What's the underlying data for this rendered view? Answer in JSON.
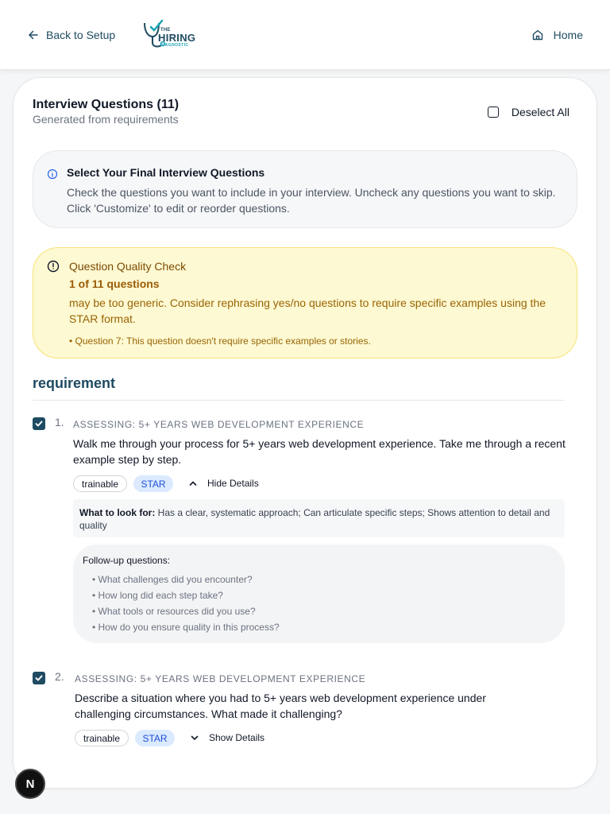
{
  "header": {
    "back_label": "Back to Setup",
    "logo": {
      "the": "THE",
      "hiring": "HIRING",
      "diagnostic": "DIAGNOSTIC"
    },
    "home_label": "Home"
  },
  "card": {
    "title": "Interview Questions (11)",
    "subtitle": "Generated from requirements",
    "deselect_label": "Deselect All"
  },
  "info": {
    "title": "Select Your Final Interview Questions",
    "body": "Check the questions you want to include in your interview. Uncheck any questions you want to skip. Click 'Customize' to edit or reorder questions."
  },
  "warning": {
    "title": "Question Quality Check",
    "count": "1 of 11 questions",
    "body": "may be too generic. Consider rephrasing yes/no questions to require specific examples using the STAR format.",
    "item": "• Question 7: This question doesn't require specific examples or stories."
  },
  "section": {
    "title": "requirement"
  },
  "questions": [
    {
      "num": "1.",
      "assessing": "ASSESSING: 5+ YEARS WEB DEVELOPMENT EXPERIENCE",
      "text": "Walk me through your process for 5+ years web development experience. Take me through a recent example step by step.",
      "tag1": "trainable",
      "tag2": "STAR",
      "toggle": "Hide Details",
      "lookfor_label": "What to look for:",
      "lookfor": "Has a clear, systematic approach; Can articulate specific steps; Shows attention to detail and quality",
      "followup_title": "Follow-up questions:",
      "followups": [
        "• What challenges did you encounter?",
        "• How long did each step take?",
        "• What tools or resources did you use?",
        "• How do you ensure quality in this process?"
      ]
    },
    {
      "num": "2.",
      "assessing": "ASSESSING: 5+ YEARS WEB DEVELOPMENT EXPERIENCE",
      "text": "Describe a situation where you had to 5+ years web development experience under challenging circumstances. What made it challenging?",
      "tag1": "trainable",
      "tag2": "STAR",
      "toggle": "Show Details"
    }
  ],
  "fab": {
    "label": "N"
  },
  "colors": {
    "brand": "#1e4b62",
    "warning_bg": "#fdf9d2",
    "info_bg": "#f6f7f8",
    "star_bg": "#dbeafe"
  }
}
